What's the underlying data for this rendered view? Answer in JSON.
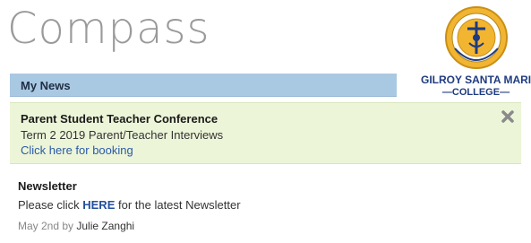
{
  "app": {
    "title": "Compass"
  },
  "logo": {
    "name": "GILROY SANTA MARIA",
    "subtitle": "—COLLEGE—",
    "icon": "school-crest-icon"
  },
  "news": {
    "header": "My News",
    "alert": {
      "title": "Parent Student Teacher Conference",
      "text": "Term 2 2019 Parent/Teacher Interviews",
      "link": "Click here for booking",
      "close_icon": "close-icon"
    },
    "items": [
      {
        "title": "Newsletter",
        "body_prefix": "Please click ",
        "body_link": "HERE",
        "body_suffix": " for the latest Newsletter",
        "date": "May 2nd by ",
        "author": "Julie Zanghi"
      }
    ]
  },
  "colors": {
    "header_bg": "#a9c8e2",
    "alert_bg": "#ecf5d8",
    "link": "#2a5aa8",
    "crest_gold": "#f2b531",
    "crest_navy": "#1f3b80"
  }
}
